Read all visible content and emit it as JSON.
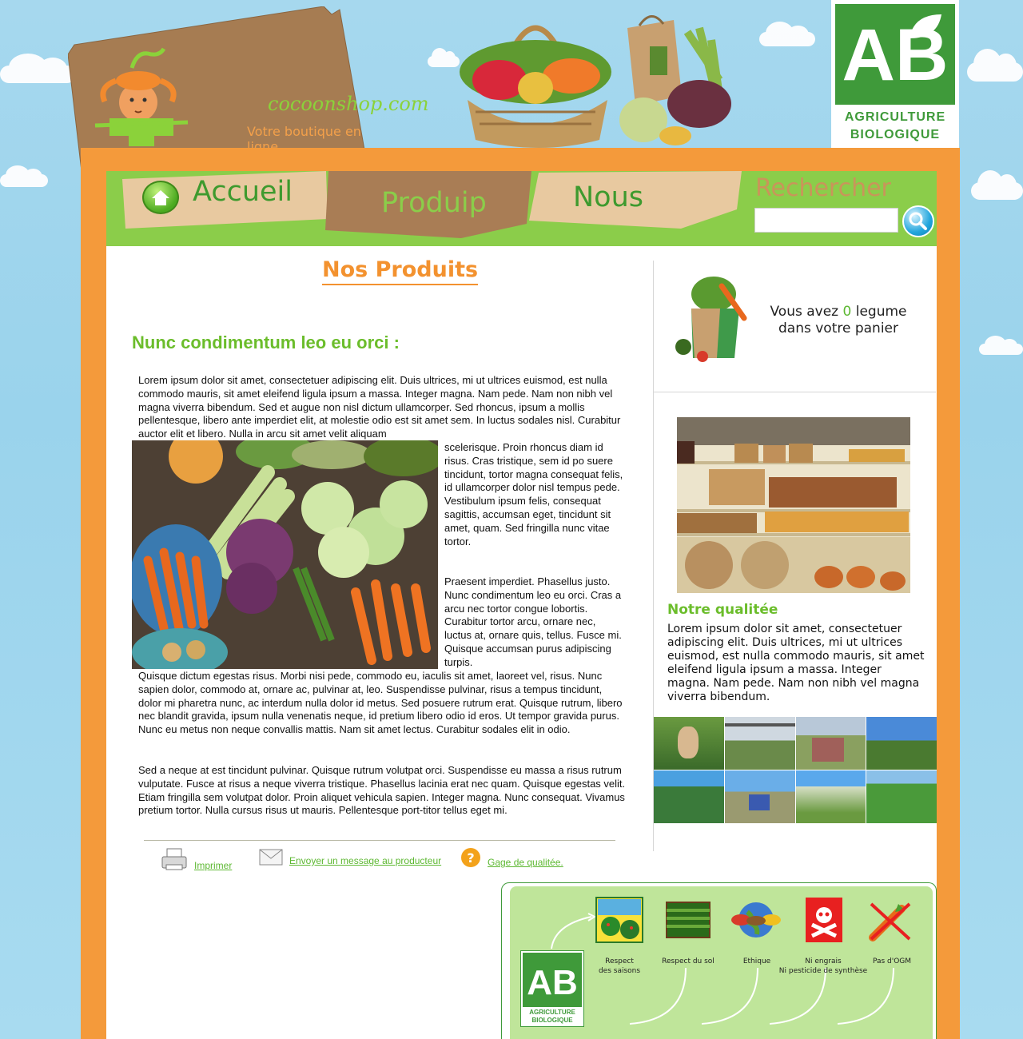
{
  "header": {
    "brand": "cocoonshop.com",
    "slogan": "Votre boutique en ligne",
    "ab_logo": {
      "letters": "AB",
      "line1": "AGRICULTURE",
      "line2": "BIOLOGIQUE"
    }
  },
  "nav": {
    "home_label": "Accueil",
    "products_label": "Produip",
    "about_label": "Nous",
    "search_title": "Rechercher",
    "search_value": ""
  },
  "main": {
    "title": "Nos Produits",
    "subtitle": "Nunc condimentum leo eu orci :",
    "para1": "Lorem ipsum dolor sit amet, consectetuer adipiscing elit. Duis ultrices, mi ut ultrices euismod, est nulla commodo mauris, sit amet eleifend ligula ipsum a massa. Integer magna. Nam pede. Nam non nibh vel magna viverra bibendum. Sed et augue non nisl dictum ullamcorper. Sed rhoncus, ipsum a mollis pellentesque, libero ante imperdiet elit, at molestie odio est sit amet sem. In luctus sodales nisl. Curabitur auctor elit et libero. Nulla in arcu sit amet velit aliquam",
    "para1_cont": "scelerisque. Proin rhoncus diam id risus. Cras tristique, sem id po suere tincidunt, tortor magna consequat felis, id ullamcorper dolor nisl tempus pede. Vestibulum ipsum felis, consequat sagittis, accumsan eget, tincidunt sit amet, quam. Sed fringilla nunc vitae tortor.",
    "para2": "Praesent imperdiet. Phasellus justo. Nunc condimentum leo eu orci. Cras a arcu nec tortor congue lobortis. Curabitur tortor arcu, ornare nec, luctus at, ornare quis, tellus. Fusce mi. Quisque accumsan purus adipiscing turpis.",
    "para2_cont": "Quisque dictum egestas risus. Morbi nisi pede, commodo eu, iaculis sit amet, laoreet vel, risus. Nunc sapien dolor, commodo at, ornare ac, pulvinar at, leo. Suspendisse pulvinar, risus a tempus tincidunt, dolor mi pharetra nunc, ac interdum nulla dolor id metus. Sed posuere rutrum erat. Quisque rutrum, libero nec blandit gravida, ipsum nulla venenatis neque, id pretium libero odio id eros. Ut tempor gravida purus. Nunc eu metus non neque convallis mattis. Nam sit amet lectus. Curabitur sodales elit in odio.",
    "para3": "Sed a neque at est tincidunt pulvinar. Quisque rutrum volutpat orci. Suspendisse eu massa a risus rutrum vulputate. Fusce at risus a neque viverra tristique. Phasellus lacinia erat nec quam. Quisque egestas velit. Etiam fringilla sem volutpat dolor. Proin aliquet vehicula sapien. Integer magna. Nunc consequat. Vivamus pretium tortor. Nulla cursus risus ut mauris. Pellentesque port-titor tellus eget mi.",
    "actions": {
      "print": "Imprimer",
      "message": "Envoyer un message au producteur",
      "quality": "Gage de qualitée."
    }
  },
  "sidebar": {
    "cart_prefix": "Vous avez ",
    "cart_count": "0",
    "cart_suffix": " legume",
    "cart_line2": "dans votre panier",
    "quality_title": "Notre qualitée",
    "quality_text": "Lorem ipsum dolor sit amet, consectetuer adipiscing elit. Duis ultrices, mi ut ultrices euismod, est nulla commodo mauris, sit amet eleifend ligula ipsum a massa. Integer magna. Nam pede. Nam non nibh vel magna viverra bibendum."
  },
  "banner": {
    "ab_letters": "AB",
    "ab_line1": "AGRICULTURE",
    "ab_line2": "BIOLOGIQUE",
    "items": [
      {
        "label1": "Respect",
        "label2": "des saisons"
      },
      {
        "label1": "Respect du sol",
        "label2": ""
      },
      {
        "label1": "Ethique",
        "label2": ""
      },
      {
        "label1": "Ni engrais",
        "label2": "Ni pesticide de synthèse"
      },
      {
        "label1": "Pas d'OGM",
        "label2": ""
      }
    ]
  },
  "colors": {
    "orange": "#f49a3b",
    "green": "#8bcd4a",
    "ab_green": "#3f9a3a",
    "link": "#5db832"
  }
}
